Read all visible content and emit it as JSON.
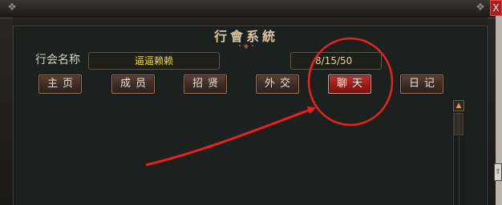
{
  "window": {
    "title": "行會系統",
    "close_label": "X",
    "corner_ornament": "❖",
    "title_ornament": "• ◆ •"
  },
  "guild": {
    "name_label": "行会名称",
    "name_value": "逼逼赖赖",
    "member_count": "8/15/50"
  },
  "tabs": [
    {
      "label": "主页",
      "active": false
    },
    {
      "label": "成员",
      "active": false
    },
    {
      "label": "招贤",
      "active": false
    },
    {
      "label": "外交",
      "active": false
    },
    {
      "label": "聊天",
      "active": true
    },
    {
      "label": "日记",
      "active": false
    }
  ],
  "scrollbar": {
    "up_icon": "▲"
  },
  "side": {
    "knob_icon": "⇧"
  },
  "colors": {
    "annotation": "#e8231c",
    "active_tab": "#b02820",
    "value_text": "#f0d52c"
  }
}
